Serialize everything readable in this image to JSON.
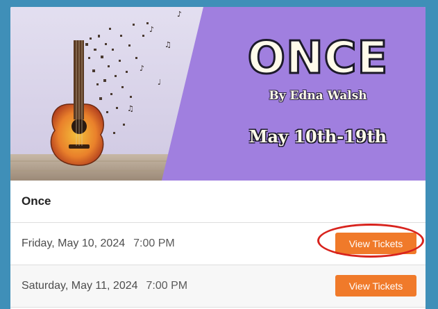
{
  "banner": {
    "title": "ONCE",
    "author": "By Edna Walsh",
    "dates": "May 10th-19th",
    "colors": {
      "panel": "#a07fdf",
      "wall": "#d9d4ea",
      "floor": "#b7a693"
    }
  },
  "event": {
    "title": "Once"
  },
  "showtimes": [
    {
      "date": "Friday, May 10, 2024",
      "time": "7:00 PM",
      "button_label": "View Tickets"
    },
    {
      "date": "Saturday, May 11, 2024",
      "time": "7:00 PM",
      "button_label": "View Tickets"
    }
  ],
  "colors": {
    "page_background": "#3f8fb8",
    "button": "#f07a2a",
    "highlight": "#d8231d"
  }
}
